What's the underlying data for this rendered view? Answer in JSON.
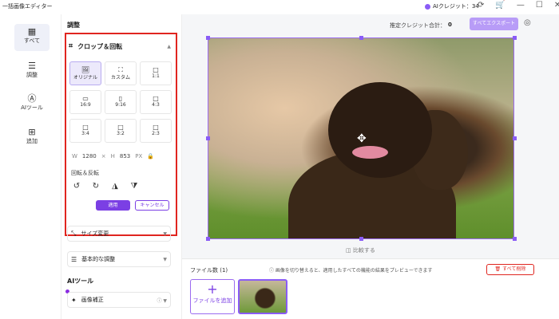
{
  "titlebar": {
    "app_title": "一括画像エディター",
    "credits": "AIクレジット：34"
  },
  "sidebar": {
    "items": [
      {
        "label": "すべて",
        "icon": "grid-icon"
      },
      {
        "label": "調整",
        "icon": "sliders-icon"
      },
      {
        "label": "AIツール",
        "icon": "ai-icon"
      },
      {
        "label": "追加",
        "icon": "plus-icon"
      }
    ]
  },
  "panel": {
    "title": "調整",
    "crop_section": "クロップ＆回転",
    "ratios": [
      "オリジナル",
      "カスタム",
      "1:1",
      "16:9",
      "9:16",
      "4:3",
      "3:4",
      "3:2",
      "2:3"
    ],
    "width_label": "W",
    "width_value": "1280",
    "times": "×",
    "height_label": "H",
    "height_value": "853",
    "unit": "PX",
    "rotate_label": "回転＆反転",
    "apply": "適用",
    "cancel": "キャンセル",
    "resize": "サイズ変更",
    "basic_adjust": "基本的な調整",
    "ai_tools_title": "AIツール",
    "enhance": "画像補正"
  },
  "main": {
    "estimated_credits_label": "推定クレジット合計：",
    "estimated_credits_value": "0",
    "export_all": "すべてエクスポート",
    "compare": "比較する",
    "file_count": "ファイル数 (1)",
    "hint": "画像を切り替えると、適用したすべての機能の結果をプレビューできます",
    "delete_all": "すべて削除",
    "add_file": "ファイルを追加"
  }
}
